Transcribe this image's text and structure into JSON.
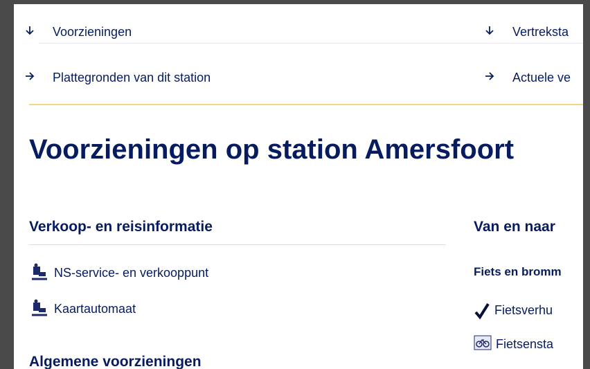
{
  "nav": {
    "left": [
      {
        "icon": "arrow-down-icon",
        "label": "Voorzieningen"
      },
      {
        "icon": "arrow-right-icon",
        "label": "Plattegronden van dit station"
      }
    ],
    "right": [
      {
        "icon": "arrow-down-icon",
        "label": "Vertreksta"
      },
      {
        "icon": "arrow-right-icon",
        "label": "Actuele ve"
      }
    ]
  },
  "page_title": "Voorzieningen op station Amersfoort",
  "sections": {
    "sales": {
      "title": "Verkoop- en reisinformatie",
      "items": [
        {
          "icon": "service-desk-icon",
          "label": "NS-service- en verkooppunt"
        },
        {
          "icon": "ticket-machine-icon",
          "label": "Kaartautomaat"
        }
      ]
    },
    "general": {
      "title": "Algemene voorzieningen"
    },
    "transport": {
      "title": "Van en naar",
      "subtitle": "Fiets en bromm",
      "items": [
        {
          "icon": "checkmark-icon",
          "label": "Fietsverhu"
        },
        {
          "icon": "bicycle-parking-icon",
          "label": "Fietsensta"
        }
      ]
    }
  }
}
